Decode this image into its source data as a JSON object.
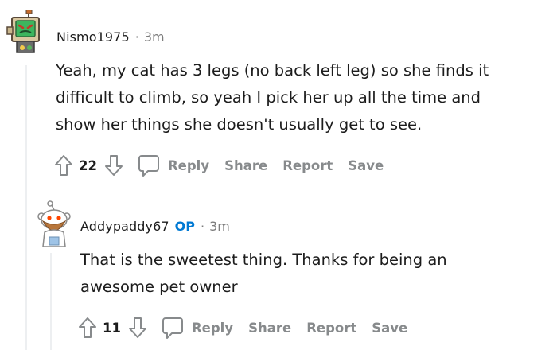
{
  "comments": [
    {
      "username": "Nismo1975",
      "is_op": false,
      "op_label": "",
      "separator": "·",
      "time": "3m",
      "avatar": "robot-avatar-icon",
      "lines": [
        "Yeah, my cat has 3 legs (no back left leg) so she finds it",
        "difficult to climb, so yeah I pick her up all the time and",
        "show her things she doesn't usually get to see."
      ],
      "votes": "22",
      "actions": {
        "reply": "Reply",
        "share": "Share",
        "report": "Report",
        "save": "Save"
      }
    },
    {
      "username": "Addypaddy67",
      "is_op": true,
      "op_label": "OP",
      "separator": "·",
      "time": "3m",
      "avatar": "snoo-avatar-icon",
      "lines": [
        "That is the sweetest thing. Thanks for being an",
        "awesome pet owner"
      ],
      "votes": "11",
      "actions": {
        "reply": "Reply",
        "share": "Share",
        "report": "Report",
        "save": "Save"
      }
    }
  ],
  "colors": {
    "text": "#1c1c1c",
    "meta": "#7c7c7c",
    "action": "#878a8c",
    "op": "#0079d3",
    "thread_line": "#edeff1"
  }
}
